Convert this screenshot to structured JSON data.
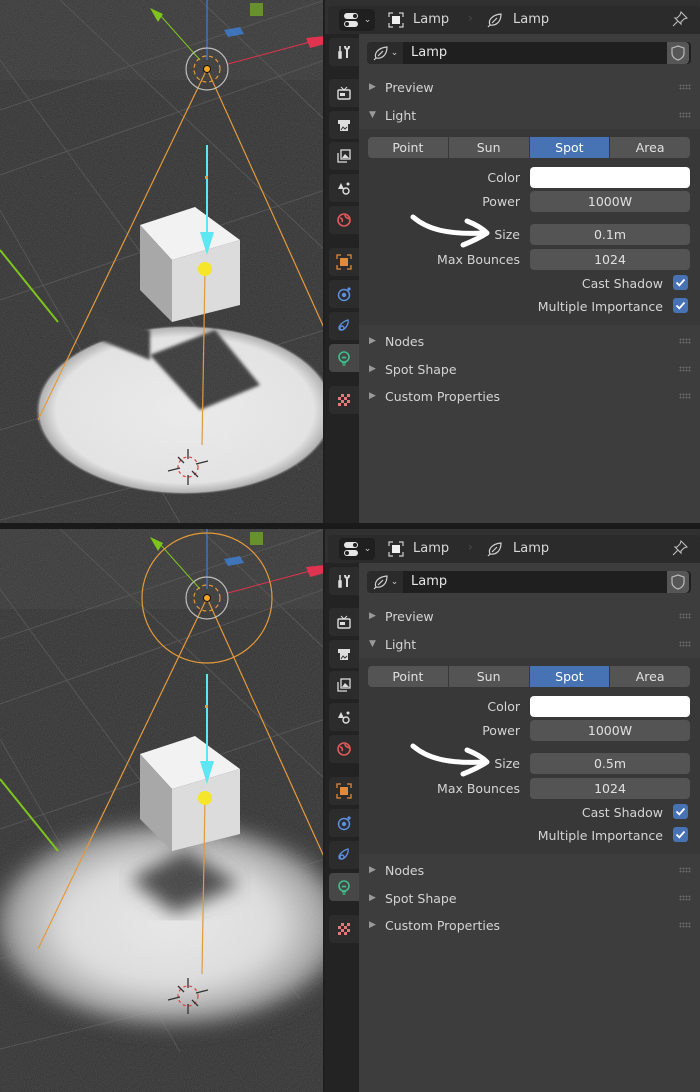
{
  "colors": {
    "accent": "#4772b3",
    "light_tab": "#3fbe8f",
    "object_orange": "#e08a3c",
    "world_red": "#e05a5a",
    "cone_orange": "#e39a3a",
    "light_direction_cyan": "#5ee6f2",
    "gizmo_yellow": "#f5e629",
    "axis_x": "#e0334f",
    "axis_y": "#7fc41d",
    "axis_z": "#3f7fd6"
  },
  "panes": [
    {
      "header": {
        "editor_icon": "properties-editor-icon",
        "breadcrumb": [
          {
            "icon": "object-icon",
            "label": "Lamp"
          },
          {
            "icon": "light-data-icon",
            "label": "Lamp"
          }
        ],
        "pin_icon": "pin-icon"
      },
      "tabs": [
        {
          "name": "tool",
          "icon": "wrench-screwdriver-icon"
        },
        {
          "name": "render",
          "icon": "render-camera-icon"
        },
        {
          "name": "output",
          "icon": "printer-icon"
        },
        {
          "name": "view-layer",
          "icon": "image-stack-icon"
        },
        {
          "name": "scene",
          "icon": "scene-icon"
        },
        {
          "name": "world",
          "icon": "world-icon"
        },
        {
          "name": "object",
          "icon": "object-icon"
        },
        {
          "name": "physics",
          "icon": "physics-icon"
        },
        {
          "name": "constraints",
          "icon": "constraint-icon"
        },
        {
          "name": "data",
          "icon": "light-bulb-icon",
          "active": true
        },
        {
          "name": "texture",
          "icon": "checker-texture-icon"
        }
      ],
      "datablock": {
        "type_icon": "light-data-icon",
        "name": "Lamp",
        "fake_user_icon": "shield-icon"
      },
      "panels": {
        "preview": {
          "title": "Preview",
          "expanded": false
        },
        "light": {
          "title": "Light",
          "expanded": true
        },
        "nodes": {
          "title": "Nodes",
          "expanded": false
        },
        "spot_shape": {
          "title": "Spot Shape",
          "expanded": false
        },
        "custom_properties": {
          "title": "Custom Properties",
          "expanded": false
        }
      },
      "light_types": [
        {
          "label": "Point",
          "active": false
        },
        {
          "label": "Sun",
          "active": false
        },
        {
          "label": "Spot",
          "active": true
        },
        {
          "label": "Area",
          "active": false
        }
      ],
      "properties": {
        "color": {
          "label": "Color",
          "value": "#ffffff"
        },
        "power": {
          "label": "Power",
          "value": "1000W"
        },
        "size": {
          "label": "Size",
          "value": "0.1m"
        },
        "max_bounces": {
          "label": "Max Bounces",
          "value": "1024"
        },
        "cast_shadow": {
          "label": "Cast Shadow",
          "checked": true
        },
        "multiple_importance": {
          "label": "Multiple Importance",
          "checked": true
        }
      },
      "annotation": "hand-drawn-arrow pointing to Size",
      "viewport": {
        "shadow": "sharp",
        "light_radius_circle": false
      }
    },
    {
      "header": {
        "editor_icon": "properties-editor-icon",
        "breadcrumb": [
          {
            "icon": "object-icon",
            "label": "Lamp"
          },
          {
            "icon": "light-data-icon",
            "label": "Lamp"
          }
        ],
        "pin_icon": "pin-icon"
      },
      "tabs": [
        {
          "name": "tool",
          "icon": "wrench-screwdriver-icon"
        },
        {
          "name": "render",
          "icon": "render-camera-icon"
        },
        {
          "name": "output",
          "icon": "printer-icon"
        },
        {
          "name": "view-layer",
          "icon": "image-stack-icon"
        },
        {
          "name": "scene",
          "icon": "scene-icon"
        },
        {
          "name": "world",
          "icon": "world-icon"
        },
        {
          "name": "object",
          "icon": "object-icon"
        },
        {
          "name": "physics",
          "icon": "physics-icon"
        },
        {
          "name": "constraints",
          "icon": "constraint-icon"
        },
        {
          "name": "data",
          "icon": "light-bulb-icon",
          "active": true
        },
        {
          "name": "texture",
          "icon": "checker-texture-icon"
        }
      ],
      "datablock": {
        "type_icon": "light-data-icon",
        "name": "Lamp",
        "fake_user_icon": "shield-icon"
      },
      "panels": {
        "preview": {
          "title": "Preview",
          "expanded": false
        },
        "light": {
          "title": "Light",
          "expanded": true
        },
        "nodes": {
          "title": "Nodes",
          "expanded": false
        },
        "spot_shape": {
          "title": "Spot Shape",
          "expanded": false
        },
        "custom_properties": {
          "title": "Custom Properties",
          "expanded": false
        }
      },
      "light_types": [
        {
          "label": "Point",
          "active": false
        },
        {
          "label": "Sun",
          "active": false
        },
        {
          "label": "Spot",
          "active": true
        },
        {
          "label": "Area",
          "active": false
        }
      ],
      "properties": {
        "color": {
          "label": "Color",
          "value": "#ffffff"
        },
        "power": {
          "label": "Power",
          "value": "1000W"
        },
        "size": {
          "label": "Size",
          "value": "0.5m"
        },
        "max_bounces": {
          "label": "Max Bounces",
          "value": "1024"
        },
        "cast_shadow": {
          "label": "Cast Shadow",
          "checked": true
        },
        "multiple_importance": {
          "label": "Multiple Importance",
          "checked": true
        }
      },
      "annotation": "hand-drawn-arrow pointing to Size",
      "viewport": {
        "shadow": "soft",
        "light_radius_circle": true
      }
    }
  ]
}
